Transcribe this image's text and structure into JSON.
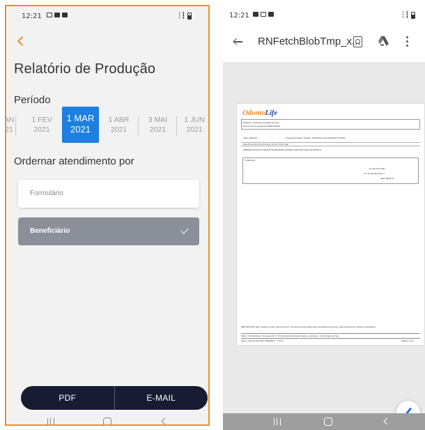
{
  "left_screen": {
    "status_bar": {
      "time": "12:21",
      "right_icons": "¥¥ ≈ ╴╴▐"
    },
    "title": "Relatório de Produção",
    "period_label": "Período",
    "periods": [
      {
        "line1": "AN",
        "line2": "21"
      },
      {
        "line1": "1 FEV",
        "line2": "2021"
      },
      {
        "line1": "1 MAR",
        "line2": "2021"
      },
      {
        "line1": "1 ABR",
        "line2": "2021"
      },
      {
        "line1": "3 MAI",
        "line2": "2021"
      },
      {
        "line1": "1 JUN",
        "line2": "2021"
      }
    ],
    "order_label": "Ordernar atendimento por",
    "options": {
      "formulario": "Formulário",
      "beneficiario": "Beneficiário"
    },
    "buttons": {
      "pdf": "PDF",
      "email": "E-MAIL"
    }
  },
  "right_screen": {
    "status_bar": {
      "time": "12:21"
    },
    "file_title": "RNFetchBlobTmp_x...",
    "document": {
      "brand_part1": "Odonto",
      "brand_part2": "Life",
      "report_line": "Relatório: Produção Cirurgião Dentista",
      "period_line": "Período de Competência: MARCO/2021",
      "cro_line": "CRO: 0000476",
      "dentist_line": "Cirurgião Dentista: TESTE - TESTE ETC DE EXEMPLO TESTE",
      "col_headers": "Guia    Nome    Nro Proc    Dt. Exec    Vl.Cto    Vl.Util    Total",
      "row1": "#######    TESTE abc DENTE SAUDE MARIA 000000    14/03/2021    300    0,00    R$ 86,12",
      "totals_label": "Totalizador",
      "total1": "N° de GTOs          300",
      "total2": "N° de atendimentos          1",
      "total3": "Valor          R$ 86,12",
      "footnote": "IMPORTANTE: Este relatório contém valores brutos. Os valores serão pagos após dedução de impostos, para conferência e ajustes necessários.",
      "legend": "Status    *-Inicidência    E - Emergencial    P - Procedimentos liberados para a empresa    A - Confirmado por App",
      "emission": "Data e Hora de Emissão:    00/03/2021 - 12:16",
      "page": "Página 1 de 1"
    }
  },
  "colors": {
    "accent": "#e8912d",
    "selected_period": "#1e7fe0",
    "action_bar": "#181c33",
    "active_option": "#8a8f98"
  }
}
